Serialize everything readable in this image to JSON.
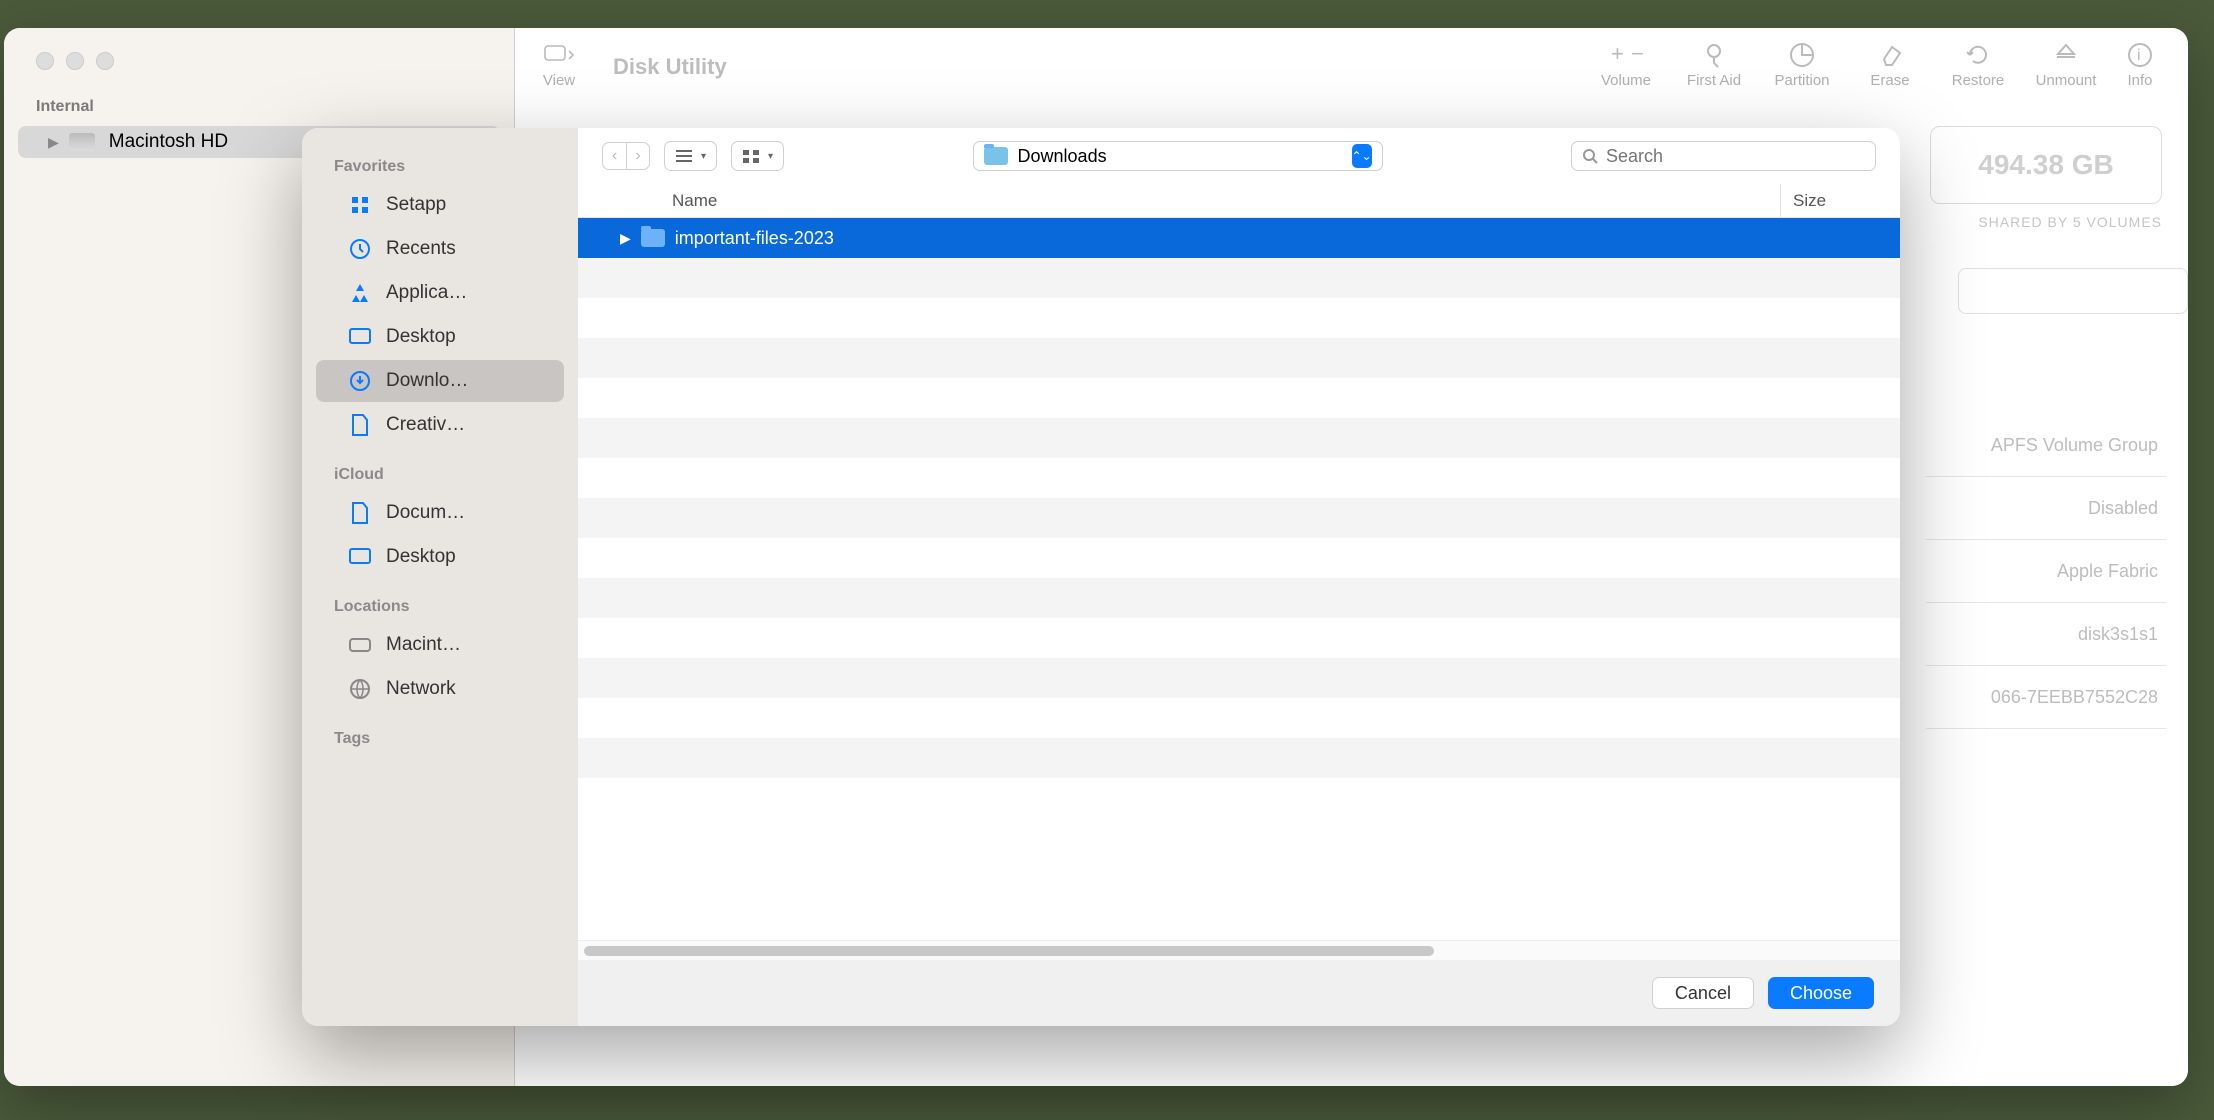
{
  "disk_utility": {
    "title": "Disk Utility",
    "view_label": "View",
    "toolbar": [
      {
        "label": "Volume",
        "icon": "plus-minus"
      },
      {
        "label": "First Aid",
        "icon": "stethoscope"
      },
      {
        "label": "Partition",
        "icon": "pie"
      },
      {
        "label": "Erase",
        "icon": "eraser"
      },
      {
        "label": "Restore",
        "icon": "restore"
      },
      {
        "label": "Unmount",
        "icon": "eject"
      },
      {
        "label": "Info",
        "icon": "info"
      }
    ],
    "sidebar": {
      "section": "Internal",
      "items": [
        {
          "label": "Macintosh HD"
        }
      ]
    },
    "info": {
      "size": "494.38 GB",
      "caption": "SHARED BY 5 VOLUMES"
    },
    "details": [
      "APFS Volume Group",
      "Disabled",
      "Apple Fabric",
      "disk3s1s1",
      "066-7EEBB7552C28"
    ]
  },
  "file_picker": {
    "sidebar": {
      "favorites_h": "Favorites",
      "favorites": [
        {
          "label": "Setapp",
          "icon": "setapp"
        },
        {
          "label": "Recents",
          "icon": "clock"
        },
        {
          "label": "Applica…",
          "icon": "apps"
        },
        {
          "label": "Desktop",
          "icon": "desktop"
        },
        {
          "label": "Downlo…",
          "icon": "download",
          "selected": true
        },
        {
          "label": "Creativ…",
          "icon": "doc"
        }
      ],
      "icloud_h": "iCloud",
      "icloud": [
        {
          "label": "Docum…",
          "icon": "doc"
        },
        {
          "label": "Desktop",
          "icon": "desktop"
        }
      ],
      "locations_h": "Locations",
      "locations": [
        {
          "label": "Macint…",
          "icon": "hdd"
        },
        {
          "label": "Network",
          "icon": "globe"
        }
      ],
      "tags_h": "Tags"
    },
    "toolbar": {
      "current_folder": "Downloads",
      "search_placeholder": "Search"
    },
    "columns": {
      "name": "Name",
      "size": "Size"
    },
    "files": [
      {
        "name": "important-files-2023",
        "selected": true,
        "is_folder": true
      }
    ],
    "buttons": {
      "cancel": "Cancel",
      "choose": "Choose"
    }
  }
}
